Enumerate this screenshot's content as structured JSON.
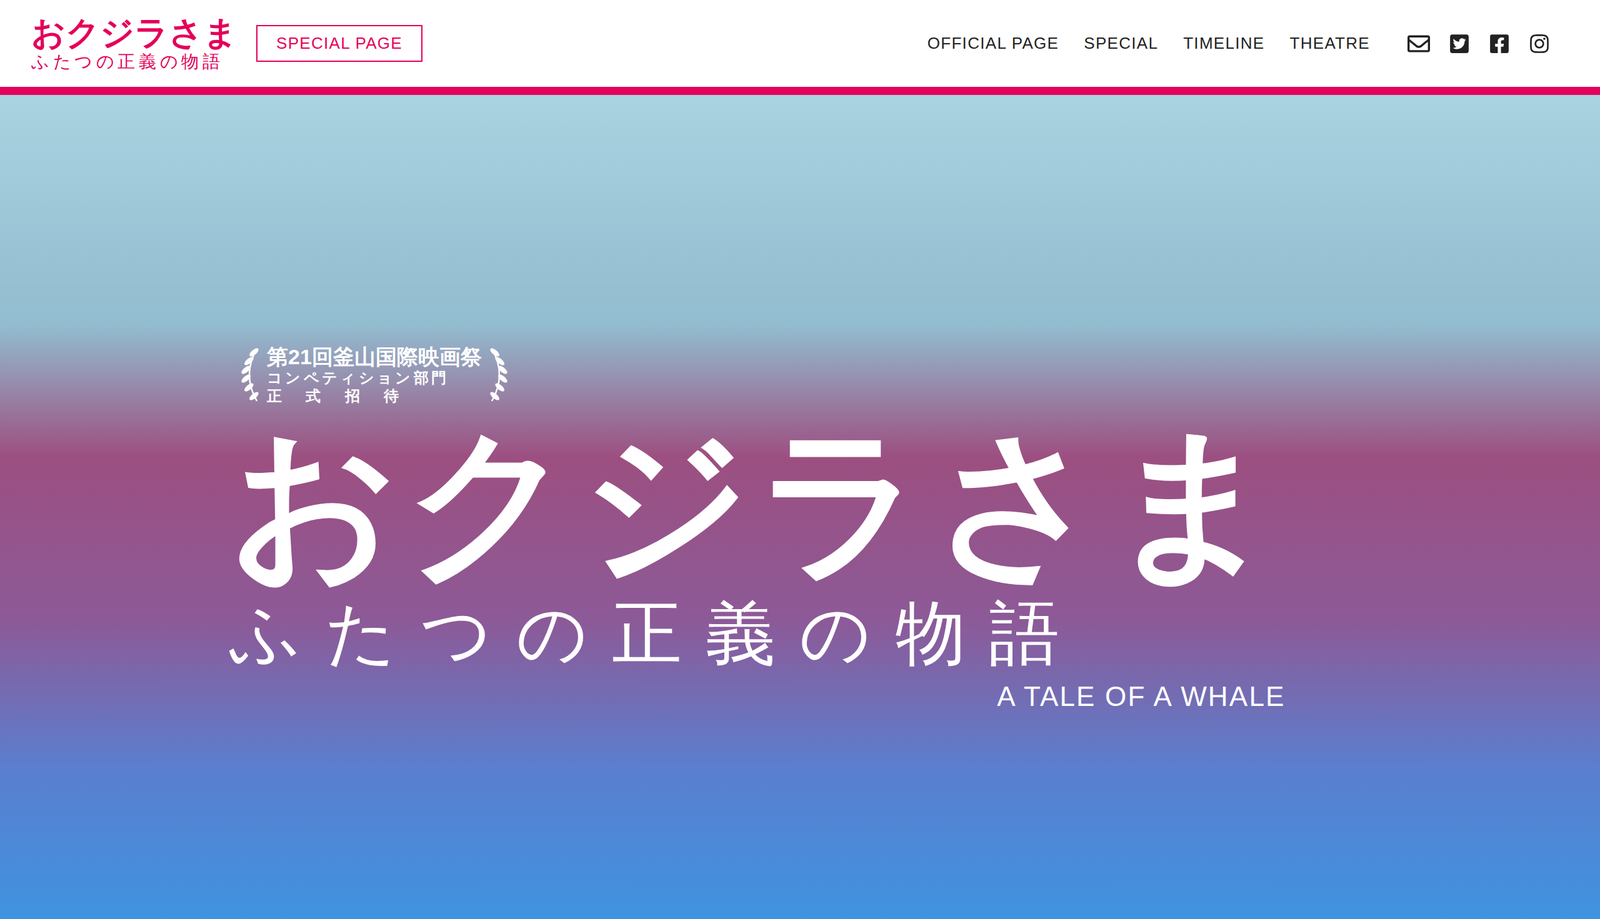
{
  "header": {
    "logo": {
      "title": "おクジラさま",
      "subtitle": "ふたつの正義の物語"
    },
    "badge": "SPECIAL PAGE",
    "nav": [
      {
        "label": "OFFICIAL PAGE",
        "selected": false
      },
      {
        "label": "SPECIAL",
        "selected": false
      },
      {
        "label": "TIMELINE",
        "selected": false
      },
      {
        "label": "THEATRE",
        "selected": false
      }
    ]
  },
  "hero": {
    "award": [
      "第21回釜山国際映画祭",
      "コンペティション部門",
      "正式招待"
    ],
    "title": "おクジラさま",
    "subtitle": "ふたつの正義の物語",
    "english": "A TALE OF A WHALE"
  }
}
